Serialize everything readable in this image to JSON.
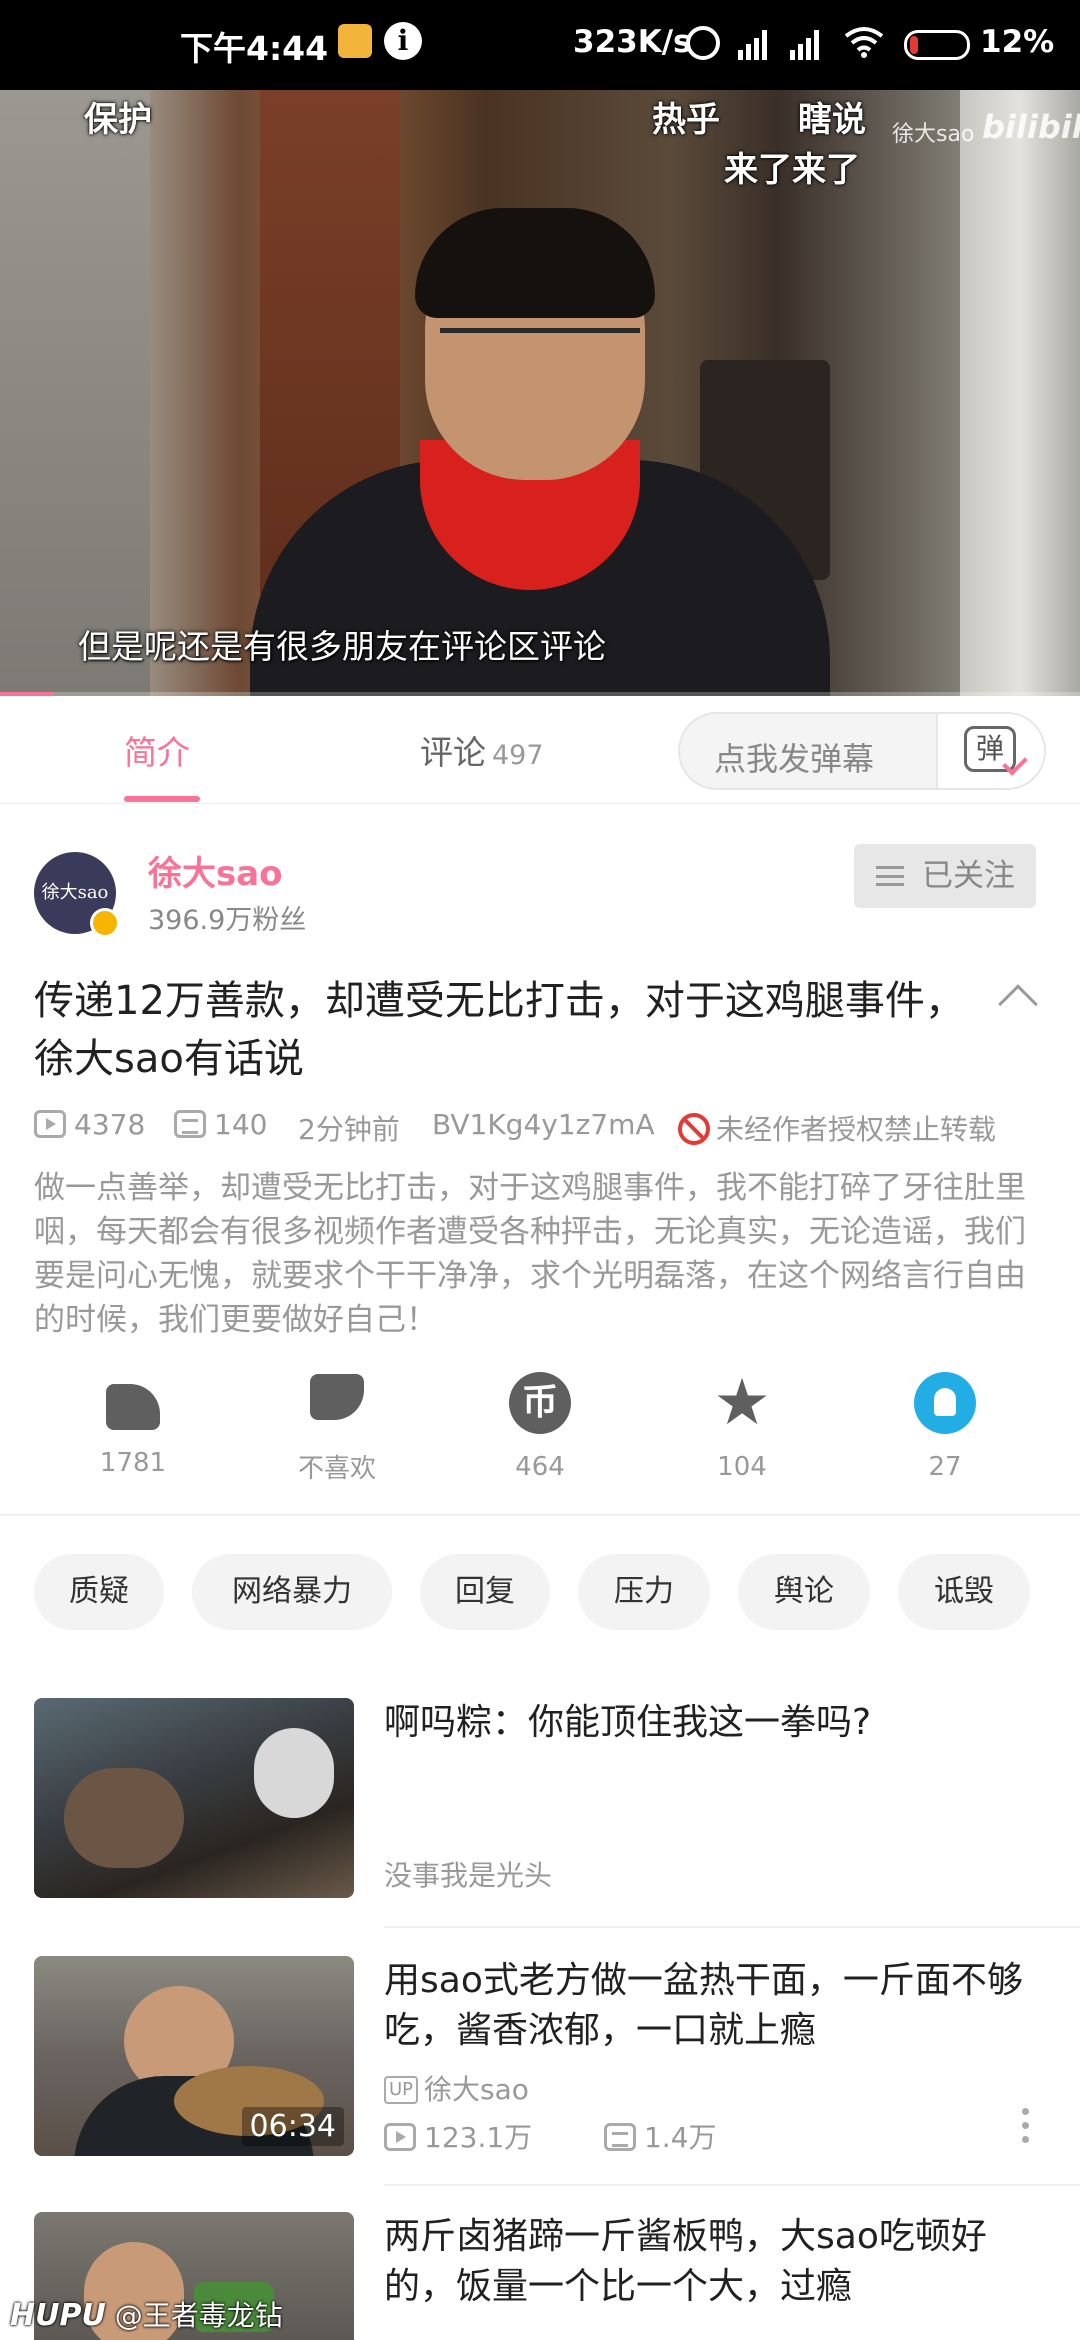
{
  "status_bar": {
    "time": "下午4:44",
    "network_speed": "323K/s",
    "battery": "12%",
    "info_glyph": "i"
  },
  "video": {
    "caption_top_left": "保护",
    "caption_top_mid1": "热乎",
    "caption_top_mid2": "瞎说",
    "caption_second_line": "来了来了",
    "subtitle": "但是呢还是有很多朋友在评论区评论",
    "watermark_user": "徐大sao",
    "watermark_brand": "bilibili",
    "progress_fraction": 0.05
  },
  "tabs": {
    "intro": "简介",
    "comments": "评论",
    "comments_count": "497"
  },
  "danmaku": {
    "placeholder": "点我发弹幕",
    "button_glyph": "弹"
  },
  "uploader": {
    "avatar_text": "徐大sao",
    "name": "徐大sao",
    "fans": "396.9万粉丝",
    "follow_label": "已关注"
  },
  "video_info": {
    "title": "传递12万善款，却遭受无比打击，对于这鸡腿事件，徐大sao有话说",
    "plays": "4378",
    "danmaku_count": "140",
    "time_ago": "2分钟前",
    "bvid": "BV1Kg4y1z7mA",
    "copyright": "未经作者授权禁止转载",
    "description": "做一点善举，却遭受无比打击，对于这鸡腿事件，我不能打碎了牙往肚里咽，每天都会有很多视频作者遭受各种抨击，无论真实，无论造谣，我们要是问心无愧，就要求个干干净净，求个光明磊落，在这个网络言行自由的时候，我们更要做好自己！"
  },
  "actions": {
    "like": "1781",
    "dislike": "不喜欢",
    "coin": "464",
    "coin_glyph": "币",
    "favorite": "104",
    "share": "27"
  },
  "tags": [
    "质疑",
    "网络暴力",
    "回复",
    "压力",
    "舆论",
    "诋毁"
  ],
  "related": [
    {
      "title": "啊吗粽：你能顶住我这一拳吗?",
      "author": "没事我是光头"
    },
    {
      "title": "用sao式老方做一盆热干面，一斤面不够吃，酱香浓郁，一口就上瘾",
      "author": "徐大sao",
      "duration": "06:34",
      "views": "123.1万",
      "danmaku": "1.4万",
      "up_badge": "UP"
    },
    {
      "title": "两斤卤猪蹄一斤酱板鸭，大sao吃顿好的，饭量一个比一个大，过瘾"
    }
  ],
  "watermark": {
    "brand": "HUPU",
    "user": "@王者毒龙钻"
  },
  "colors": {
    "accent_pink": "#fb7299",
    "share_blue": "#23ade5",
    "ban_red": "#e53935"
  }
}
